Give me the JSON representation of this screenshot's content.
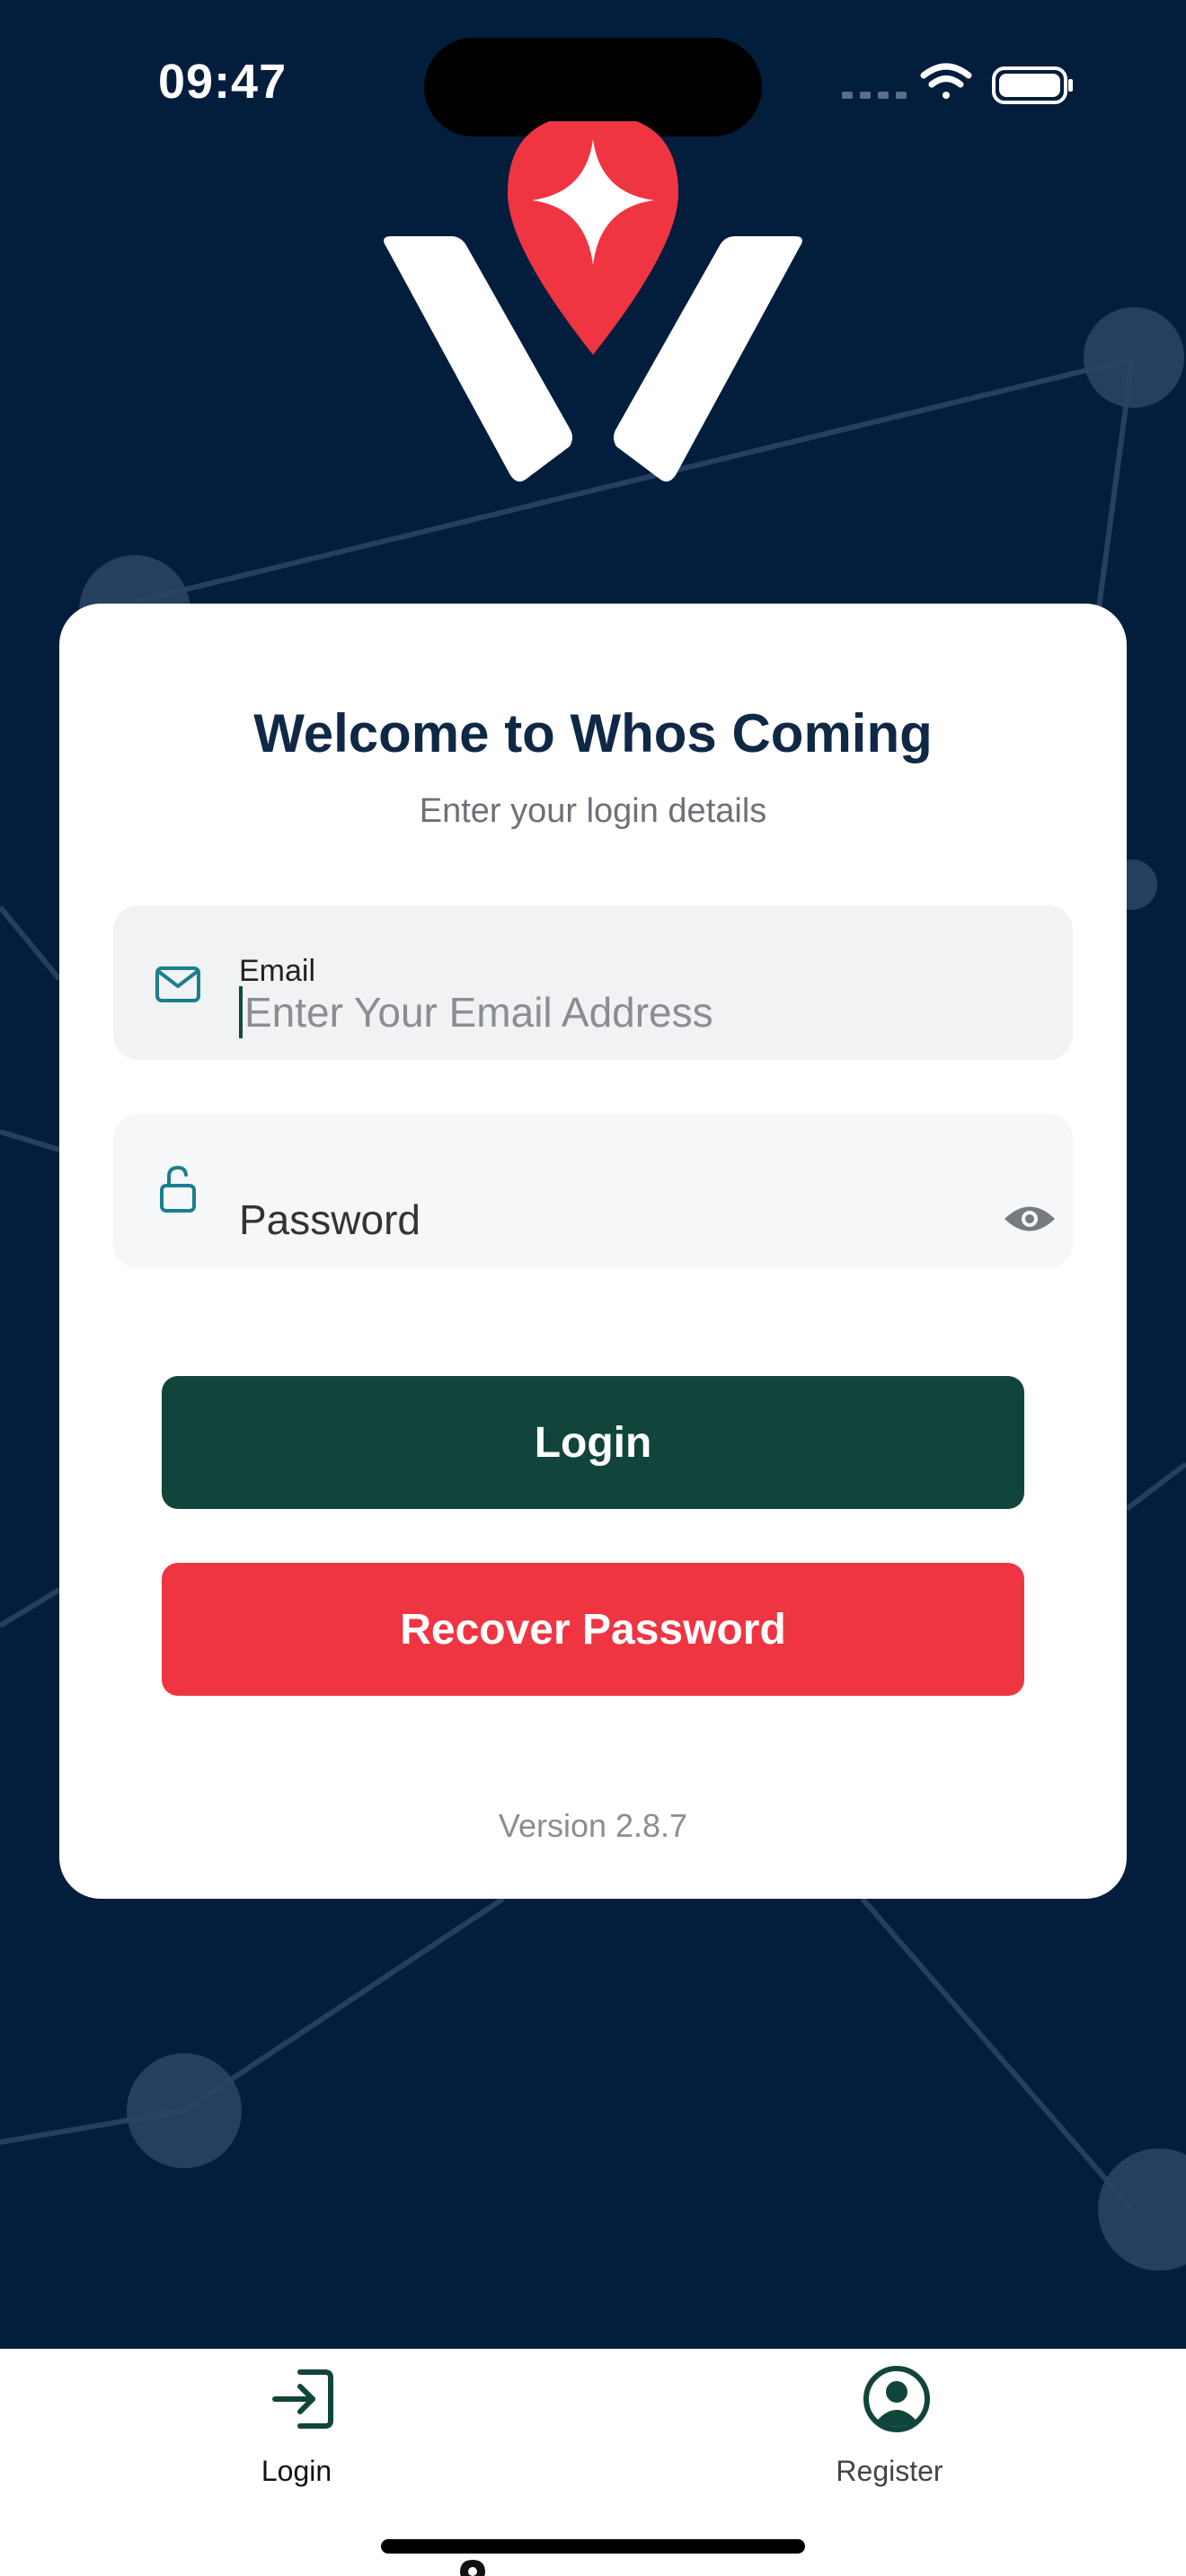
{
  "status_bar": {
    "time": "09:47"
  },
  "brand": {
    "logo_icon": "whos-coming-logo",
    "primary_color": "#11453b",
    "accent_color": "#ef3542",
    "background_color": "#031d3d"
  },
  "card": {
    "title": "Welcome to Whos Coming",
    "subtitle": "Enter your login details",
    "email": {
      "label": "Email",
      "placeholder": "Enter Your Email Address",
      "value": "",
      "icon": "mail-icon"
    },
    "password": {
      "placeholder": "Password",
      "value": "",
      "icon": "unlock-icon",
      "toggle_icon": "eye-icon"
    },
    "login_button": "Login",
    "recover_button": "Recover Password",
    "version": "Version 2.8.7"
  },
  "tabbar": {
    "items": [
      {
        "label": "Login",
        "icon": "login-icon",
        "active": true
      },
      {
        "label": "Register",
        "icon": "user-circle-icon",
        "active": false
      }
    ]
  }
}
